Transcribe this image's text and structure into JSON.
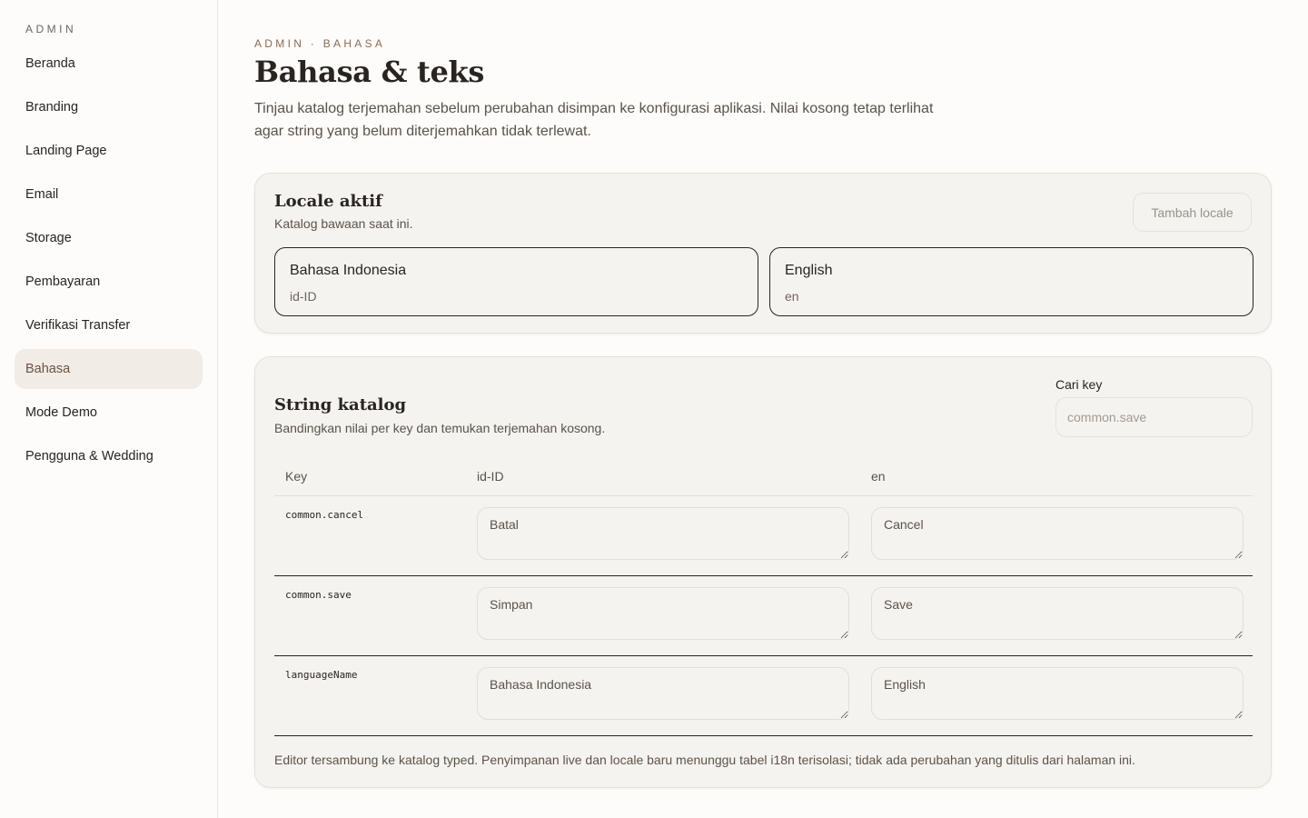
{
  "sidebar": {
    "brand": "ADMIN",
    "items": [
      {
        "label": "Beranda"
      },
      {
        "label": "Branding"
      },
      {
        "label": "Landing Page"
      },
      {
        "label": "Email"
      },
      {
        "label": "Storage"
      },
      {
        "label": "Pembayaran"
      },
      {
        "label": "Verifikasi Transfer"
      },
      {
        "label": "Bahasa",
        "active": true
      },
      {
        "label": "Mode Demo"
      },
      {
        "label": "Pengguna & Wedding"
      }
    ]
  },
  "header": {
    "eyebrow": "ADMIN · BAHASA",
    "title": "Bahasa & teks",
    "description": "Tinjau katalog terjemahan sebelum perubahan disimpan ke konfigurasi aplikasi. Nilai kosong tetap terlihat agar string yang belum diterjemahkan tidak terlewat."
  },
  "locale_card": {
    "title": "Locale aktif",
    "subtitle": "Katalog bawaan saat ini.",
    "add_button": "Tambah locale",
    "locales": [
      {
        "name": "Bahasa Indonesia",
        "code": "id-ID"
      },
      {
        "name": "English",
        "code": "en"
      }
    ]
  },
  "strings_card": {
    "title": "String katalog",
    "subtitle": "Bandingkan nilai per key dan temukan terjemahan kosong.",
    "search": {
      "label": "Cari key",
      "placeholder": "common.save",
      "value": ""
    },
    "columns": [
      "Key",
      "id-ID",
      "en"
    ],
    "rows": [
      {
        "key": "common.cancel",
        "id": "Batal",
        "en": "Cancel"
      },
      {
        "key": "common.save",
        "id": "Simpan",
        "en": "Save"
      },
      {
        "key": "languageName",
        "id": "Bahasa Indonesia",
        "en": "English"
      }
    ],
    "footnote": "Editor tersambung ke katalog typed. Penyimpanan live dan locale baru menunggu tabel i18n terisolasi; tidak ada perubahan yang ditulis dari halaman ini."
  },
  "colors": {
    "background": "#fdfcfa",
    "card": "#f5f3ef",
    "accent": "#8a6a52",
    "active_nav": "#f1ece5",
    "text": "#2a2420"
  }
}
